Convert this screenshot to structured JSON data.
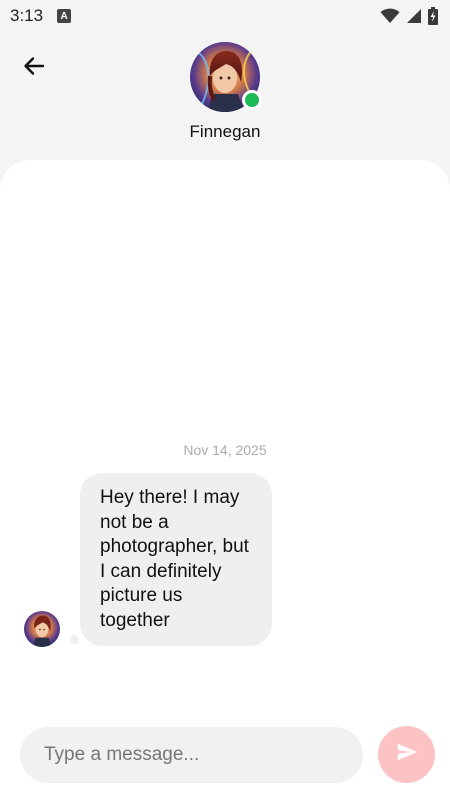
{
  "status_bar": {
    "time": "3:13",
    "app_icon_letter": "A",
    "icons": [
      "wifi-icon",
      "signal-icon",
      "battery-charging-icon"
    ]
  },
  "header": {
    "back_icon": "arrow-left-icon",
    "contact_name": "Finnegan",
    "online": true
  },
  "chat": {
    "date": "Nov 14, 2025",
    "messages": [
      {
        "sender": "Finnegan",
        "text": "Hey there! I may not be a photographer, but I can definitely picture us together"
      }
    ]
  },
  "composer": {
    "placeholder": "Type a message...",
    "value": "",
    "send_icon": "send-icon"
  },
  "colors": {
    "online": "#1db954",
    "send_button": "#fbc3c4",
    "bubble": "#efefef",
    "background": "#f4f4f4"
  }
}
